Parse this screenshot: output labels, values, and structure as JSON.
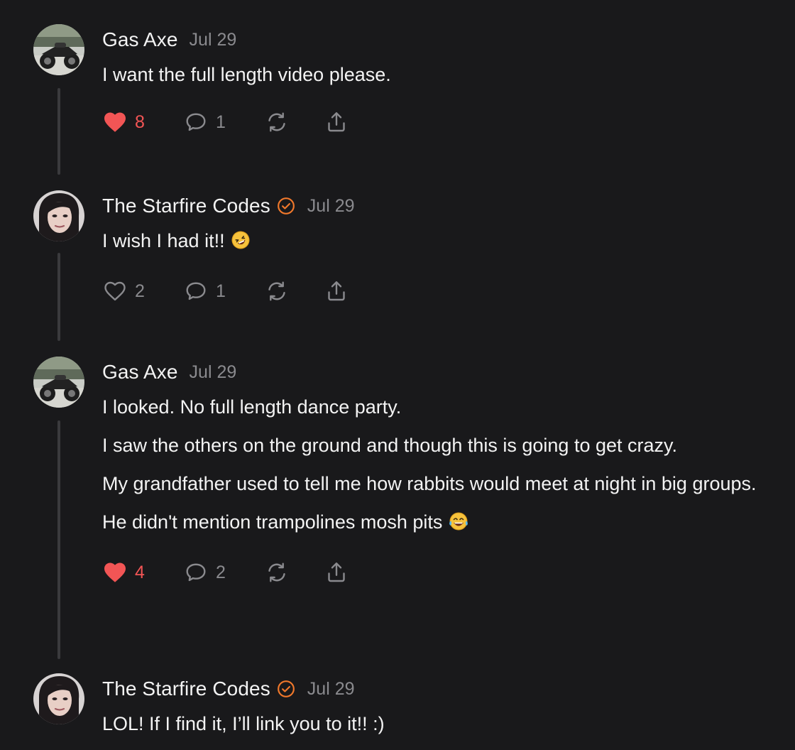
{
  "colors": {
    "background": "#19191b",
    "text": "#f3f3f3",
    "muted": "#8a8a8e",
    "accent": "#f0782b",
    "like": "#f25555",
    "thread_line": "#3a3a3d"
  },
  "comments": [
    {
      "author": "Gas Axe",
      "verified": false,
      "date": "Jul 29",
      "avatar": "motorcycle-avatar",
      "paragraphs": [
        {
          "text": "I want the full length video please.",
          "emoji": ""
        }
      ],
      "likes": "8",
      "liked": true,
      "replies": "1"
    },
    {
      "author": "The Starfire Codes",
      "verified": true,
      "date": "Jul 29",
      "avatar": "woman-avatar",
      "paragraphs": [
        {
          "text": "I wish I had it!!",
          "emoji": "rolling-on-floor-laughing-emoji"
        }
      ],
      "likes": "2",
      "liked": false,
      "replies": "1"
    },
    {
      "author": "Gas Axe",
      "verified": false,
      "date": "Jul 29",
      "avatar": "motorcycle-avatar",
      "paragraphs": [
        {
          "text": "I looked. No full length dance party.",
          "emoji": ""
        },
        {
          "text": "I saw the others on the ground and though this is going to get crazy.",
          "emoji": ""
        },
        {
          "text": "My grandfather used to tell me how rabbits would meet at night in big groups.",
          "emoji": ""
        },
        {
          "text": "He didn't mention trampolines mosh pits",
          "emoji": "tears-of-joy-emoji"
        }
      ],
      "likes": "4",
      "liked": true,
      "replies": "2"
    },
    {
      "author": "The Starfire Codes",
      "verified": true,
      "date": "Jul 29",
      "avatar": "woman-avatar",
      "paragraphs": [
        {
          "text": "LOL! If I find it, I’ll link you to it!! :)",
          "emoji": ""
        }
      ]
    }
  ]
}
